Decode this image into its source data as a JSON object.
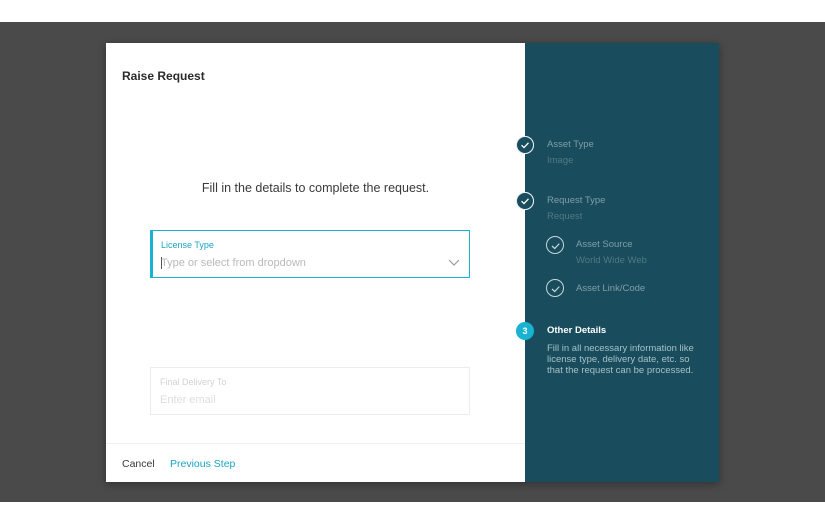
{
  "modal": {
    "title": "Raise Request",
    "headline": "Fill in the details to complete the request.",
    "license_field": {
      "label": "License Type",
      "placeholder": "Type or select from dropdown",
      "chevron_icon": "chevron-down-icon"
    },
    "delivery_field": {
      "label": "Final Delivery To",
      "placeholder": "Enter email"
    },
    "footer": {
      "cancel_label": "Cancel",
      "previous_label": "Previous Step"
    }
  },
  "steps": {
    "asset_type": {
      "title": "Asset Type",
      "value": "Image",
      "status": "completed",
      "icon": "check-icon"
    },
    "request_type": {
      "title": "Request Type",
      "value": "Request",
      "status": "completed",
      "icon": "check-icon"
    },
    "asset_source": {
      "title": "Asset Source",
      "value": "World Wide Web",
      "status": "completed",
      "icon": "check-icon"
    },
    "asset_link": {
      "title": "Asset Link/Code",
      "status": "completed",
      "icon": "check-icon"
    },
    "other_details": {
      "number": "3",
      "title": "Other Details",
      "description": "Fill in all necessary information like license type, delivery date, etc. so that the request can be processed.",
      "status": "active"
    }
  },
  "colors": {
    "accent": "#19b2d0",
    "sidebar_bg": "#194d5d",
    "overlay": "#4a4a4a"
  }
}
